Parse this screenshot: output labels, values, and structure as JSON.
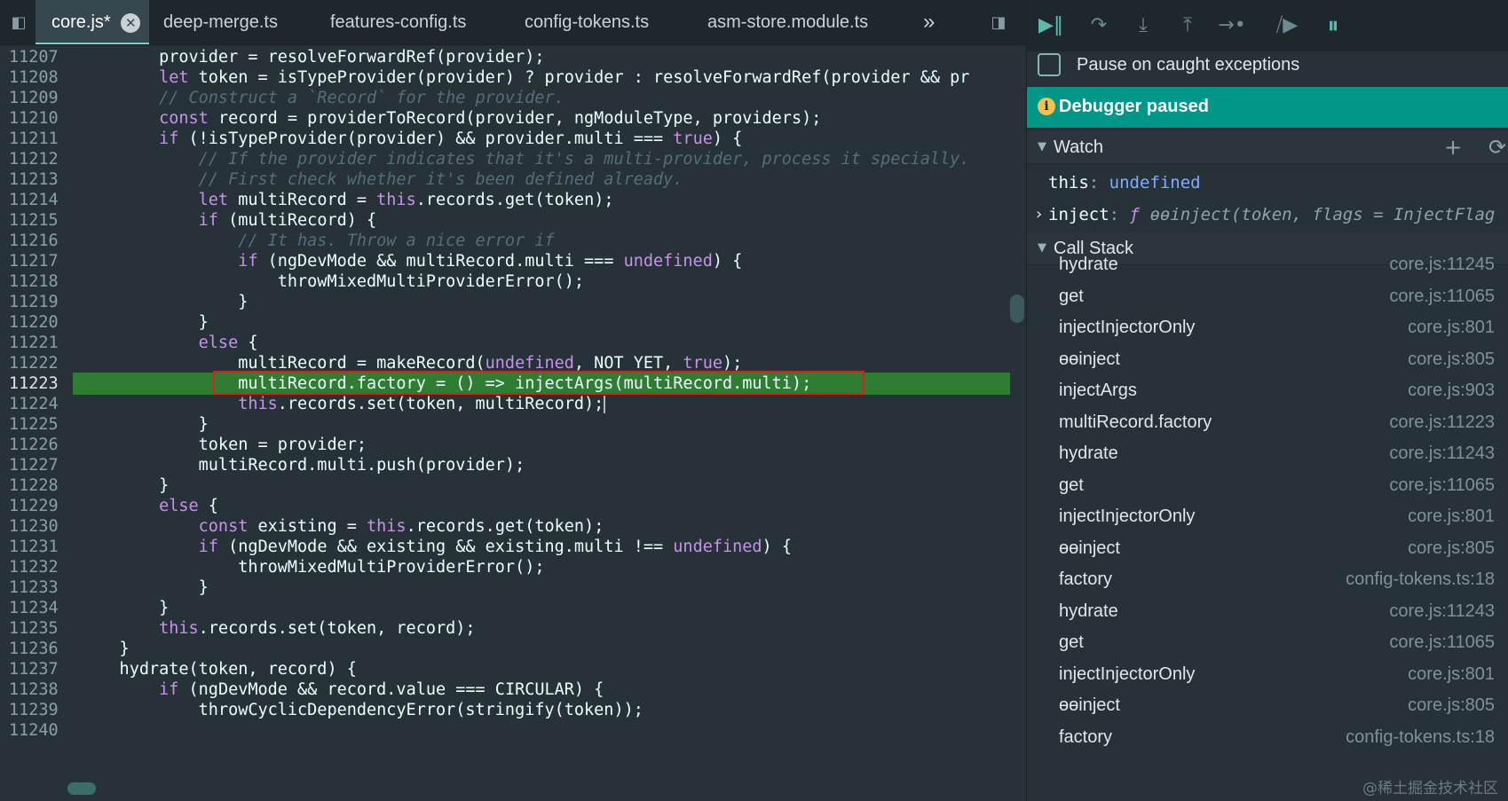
{
  "tabs": {
    "items": [
      {
        "label": "core.js*",
        "active": true
      },
      {
        "label": "deep-merge.ts",
        "active": false
      },
      {
        "label": "features-config.ts",
        "active": false
      },
      {
        "label": "config-tokens.ts",
        "active": false
      },
      {
        "label": "asm-store.module.ts",
        "active": false
      }
    ],
    "overflow": "»",
    "close": "✕"
  },
  "editor": {
    "current_line": "11223",
    "lines": [
      {
        "n": "11207",
        "t": [
          [
            "fn",
            "        provider = resolveForwardRef(provider);"
          ]
        ]
      },
      {
        "n": "11208",
        "t": [
          [
            "kw",
            "        let "
          ],
          [
            "fn",
            "token = isTypeProvider(provider) ? provider : resolveForwardRef(provider && pr"
          ]
        ]
      },
      {
        "n": "11209",
        "t": [
          [
            "cm",
            "        // Construct a `Record` for the provider."
          ]
        ]
      },
      {
        "n": "11210",
        "t": [
          [
            "kw",
            "        const "
          ],
          [
            "fn",
            "record = providerToRecord(provider, ngModuleType, providers);"
          ]
        ]
      },
      {
        "n": "11211",
        "t": [
          [
            "kw",
            "        if "
          ],
          [
            "fn",
            "(!isTypeProvider(provider) && provider.multi === "
          ],
          [
            "lit",
            "true"
          ],
          [
            "fn",
            ") {"
          ]
        ]
      },
      {
        "n": "11212",
        "t": [
          [
            "cm",
            "            // If the provider indicates that it's a multi-provider, process it specially."
          ]
        ]
      },
      {
        "n": "11213",
        "t": [
          [
            "cm",
            "            // First check whether it's been defined already."
          ]
        ]
      },
      {
        "n": "11214",
        "t": [
          [
            "kw",
            "            let "
          ],
          [
            "fn",
            "multiRecord = "
          ],
          [
            "kw",
            "this"
          ],
          [
            "fn",
            ".records.get(token);"
          ]
        ]
      },
      {
        "n": "11215",
        "t": [
          [
            "kw",
            "            if "
          ],
          [
            "fn",
            "(multiRecord) {"
          ]
        ]
      },
      {
        "n": "11216",
        "t": [
          [
            "cm",
            "                // It has. Throw a nice error if"
          ]
        ]
      },
      {
        "n": "11217",
        "t": [
          [
            "kw",
            "                if "
          ],
          [
            "fn",
            "(ngDevMode && multiRecord.multi === "
          ],
          [
            "lit",
            "undefined"
          ],
          [
            "fn",
            ") {"
          ]
        ]
      },
      {
        "n": "11218",
        "t": [
          [
            "fn",
            "                    throwMixedMultiProviderError();"
          ]
        ]
      },
      {
        "n": "11219",
        "t": [
          [
            "fn",
            "                }"
          ]
        ]
      },
      {
        "n": "11220",
        "t": [
          [
            "fn",
            "            }"
          ]
        ]
      },
      {
        "n": "11221",
        "t": [
          [
            "kw",
            "            else "
          ],
          [
            "fn",
            "{"
          ]
        ]
      },
      {
        "n": "11222",
        "t": [
          [
            "fn",
            "                multiRecord = makeRecord("
          ],
          [
            "lit",
            "undefined"
          ],
          [
            "fn",
            ", NOT_YET, "
          ],
          [
            "lit",
            "true"
          ],
          [
            "fn",
            ");"
          ]
        ]
      },
      {
        "n": "11223",
        "t": [
          [
            "fn",
            "                multiRecord.factory = () => injectArgs(multiRecord.multi);"
          ]
        ]
      },
      {
        "n": "11224",
        "t": [
          [
            "kw",
            "                this"
          ],
          [
            "fn",
            ".records.set(token, multiRecord);"
          ]
        ]
      },
      {
        "n": "11225",
        "t": [
          [
            "fn",
            "            }"
          ]
        ]
      },
      {
        "n": "11226",
        "t": [
          [
            "fn",
            "            token = provider;"
          ]
        ]
      },
      {
        "n": "11227",
        "t": [
          [
            "fn",
            "            multiRecord.multi.push(provider);"
          ]
        ]
      },
      {
        "n": "11228",
        "t": [
          [
            "fn",
            "        }"
          ]
        ]
      },
      {
        "n": "11229",
        "t": [
          [
            "kw",
            "        else "
          ],
          [
            "fn",
            "{"
          ]
        ]
      },
      {
        "n": "11230",
        "t": [
          [
            "kw",
            "            const "
          ],
          [
            "fn",
            "existing = "
          ],
          [
            "kw",
            "this"
          ],
          [
            "fn",
            ".records.get(token);"
          ]
        ]
      },
      {
        "n": "11231",
        "t": [
          [
            "kw",
            "            if "
          ],
          [
            "fn",
            "(ngDevMode && existing && existing.multi !== "
          ],
          [
            "lit",
            "undefined"
          ],
          [
            "fn",
            ") {"
          ]
        ]
      },
      {
        "n": "11232",
        "t": [
          [
            "fn",
            "                throwMixedMultiProviderError();"
          ]
        ]
      },
      {
        "n": "11233",
        "t": [
          [
            "fn",
            "            }"
          ]
        ]
      },
      {
        "n": "11234",
        "t": [
          [
            "fn",
            "        }"
          ]
        ]
      },
      {
        "n": "11235",
        "t": [
          [
            "kw",
            "        this"
          ],
          [
            "fn",
            ".records.set(token, record);"
          ]
        ]
      },
      {
        "n": "11236",
        "t": [
          [
            "fn",
            "    }"
          ]
        ]
      },
      {
        "n": "11237",
        "t": [
          [
            "fn",
            "    hydrate(token, record) {"
          ]
        ]
      },
      {
        "n": "11238",
        "t": [
          [
            "kw",
            "        if "
          ],
          [
            "fn",
            "(ngDevMode && record.value === CIRCULAR) {"
          ]
        ]
      },
      {
        "n": "11239",
        "t": [
          [
            "fn",
            "            throwCyclicDependencyError(stringify(token));"
          ]
        ]
      },
      {
        "n": "11240",
        "t": []
      }
    ]
  },
  "debugger": {
    "pause_on_caught_label": "Pause on caught exceptions",
    "paused_banner": "Debugger paused",
    "watch": {
      "title": "Watch",
      "add_icon": "+",
      "refresh_icon": "⟳",
      "items": [
        {
          "name": "this",
          "value": "undefined"
        },
        {
          "name": "inject",
          "fn_marker": "ƒ",
          "value": "ɵɵinject(token, flags = InjectFlag"
        }
      ]
    },
    "call_stack": {
      "title": "Call Stack",
      "frames": [
        {
          "name": "hydrate",
          "loc": "core.js:11245"
        },
        {
          "name": "get",
          "loc": "core.js:11065"
        },
        {
          "name": "injectInjectorOnly",
          "loc": "core.js:801"
        },
        {
          "name": "ɵɵinject",
          "loc": "core.js:805"
        },
        {
          "name": "injectArgs",
          "loc": "core.js:903"
        },
        {
          "name": "multiRecord.factory",
          "loc": "core.js:11223"
        },
        {
          "name": "hydrate",
          "loc": "core.js:11243"
        },
        {
          "name": "get",
          "loc": "core.js:11065"
        },
        {
          "name": "injectInjectorOnly",
          "loc": "core.js:801"
        },
        {
          "name": "ɵɵinject",
          "loc": "core.js:805"
        },
        {
          "name": "factory",
          "loc": "config-tokens.ts:18"
        },
        {
          "name": "hydrate",
          "loc": "core.js:11243"
        },
        {
          "name": "get",
          "loc": "core.js:11065"
        },
        {
          "name": "injectInjectorOnly",
          "loc": "core.js:801"
        },
        {
          "name": "ɵɵinject",
          "loc": "core.js:805"
        },
        {
          "name": "factory",
          "loc": "config-tokens.ts:18"
        }
      ]
    },
    "watermark": "@稀土掘金技术社区"
  },
  "icons": {
    "toggle_navigator": "sidebar-toggle-icon",
    "toggle_debugger": "debugger-panel-toggle-icon",
    "resume": "resume-icon",
    "step_over": "step-over-icon",
    "step_into": "step-into-icon",
    "step_out": "step-out-icon",
    "step": "step-icon",
    "deactivate_breakpoints": "deactivate-breakpoints-icon",
    "pause_on_exceptions": "pause-on-exceptions-icon"
  },
  "colors": {
    "editor_bg": "#263238",
    "current_line": "#2e7d32",
    "paused_banner": "#009688",
    "annotation_box": "#e01c1c",
    "keyword": "#c792ea"
  }
}
